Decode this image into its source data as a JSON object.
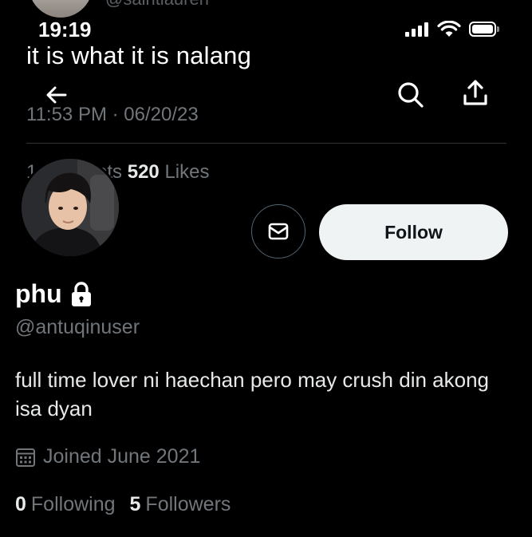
{
  "background_tweet": {
    "handle": "@saintlauren",
    "text": "it is what it is nalang",
    "timestamp": "11:53 PM · 06/20/23",
    "stats_prefix": "1 Retweets",
    "likes_count": "520",
    "likes_label": "Likes"
  },
  "status_bar": {
    "time": "19:19"
  },
  "nav": {
    "back_icon": "arrow-left-icon",
    "search_icon": "search-icon",
    "share_icon": "share-icon"
  },
  "profile": {
    "display_name": "phu",
    "handle": "@antuqinuser",
    "bio": "full time lover ni haechan pero may crush din akong isa dyan",
    "joined": "Joined June 2021",
    "following_count": "0",
    "following_label": "Following",
    "followers_count": "5",
    "followers_label": "Followers",
    "protected_icon": "lock-icon"
  },
  "actions": {
    "follow_label": "Follow",
    "message_icon": "mail-icon"
  },
  "colors": {
    "background": "#000000",
    "text_primary": "#e7e9ea",
    "text_secondary": "#71767b",
    "follow_button": "#eff3f4",
    "divider": "#2f3336"
  }
}
